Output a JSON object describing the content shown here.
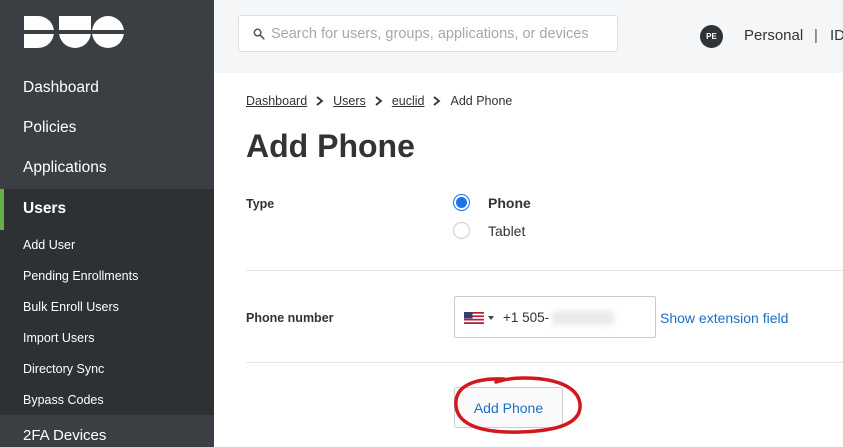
{
  "sidebar": {
    "logo_text": "DUO",
    "items": [
      {
        "label": "Dashboard"
      },
      {
        "label": "Policies"
      },
      {
        "label": "Applications"
      }
    ],
    "active": {
      "label": "Users"
    },
    "sub_items": [
      {
        "label": "Add User"
      },
      {
        "label": "Pending Enrollments"
      },
      {
        "label": "Bulk Enroll Users"
      },
      {
        "label": "Import Users"
      },
      {
        "label": "Directory Sync"
      },
      {
        "label": "Bypass Codes"
      }
    ],
    "after": {
      "label": "2FA Devices"
    },
    "accent_color": "#63b344"
  },
  "header": {
    "search_placeholder": "Search for users, groups, applications, or devices",
    "avatar_initials": "PE",
    "account_name": "Personal",
    "separator": "|",
    "id_label": "ID"
  },
  "breadcrumb": {
    "items": [
      {
        "label": "Dashboard"
      },
      {
        "label": "Users"
      },
      {
        "label": "euclid"
      }
    ],
    "current": "Add Phone"
  },
  "page": {
    "title": "Add Phone"
  },
  "form": {
    "type_label": "Type",
    "type_options": [
      {
        "label": "Phone",
        "selected": true
      },
      {
        "label": "Tablet",
        "selected": false
      }
    ],
    "phone_label": "Phone number",
    "country_flag": "us-flag-icon",
    "phone_prefix": "+1 505-",
    "extension_link": "Show extension field",
    "submit_label": "Add Phone"
  },
  "colors": {
    "link": "#1a6fc8",
    "radio_selected": "#1a73e8",
    "annotation": "#d0191f"
  }
}
